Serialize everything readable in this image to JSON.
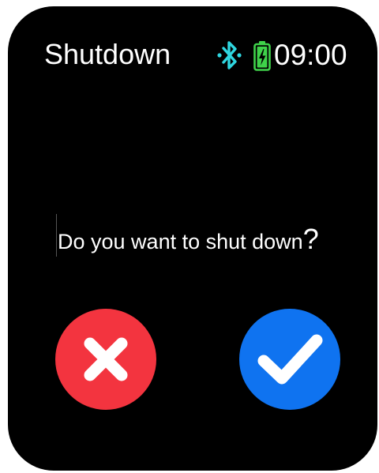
{
  "status_bar": {
    "title": "Shutdown",
    "time": "09:00",
    "icons": {
      "bluetooth": "bluetooth-icon",
      "battery": "battery-charging-icon"
    },
    "colors": {
      "bluetooth": "#2fd6e0",
      "battery": "#3fd24a"
    }
  },
  "dialog": {
    "prompt": "Do you want to shut down",
    "question_mark": "?"
  },
  "actions": {
    "cancel": {
      "icon": "close-x-icon",
      "color": "#f3343f"
    },
    "confirm": {
      "icon": "checkmark-icon",
      "color": "#0f73f0"
    }
  }
}
